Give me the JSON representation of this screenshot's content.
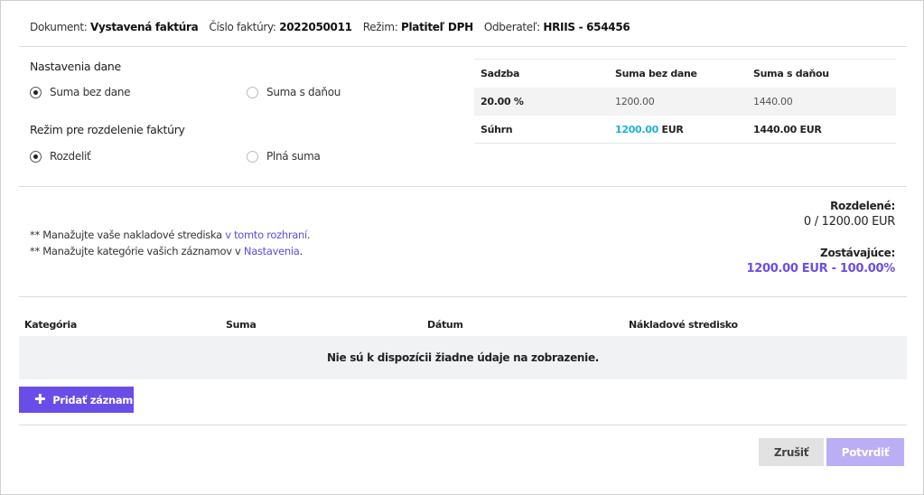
{
  "header": {
    "document_label": "Dokument:",
    "document_value": "Vystavená faktúra",
    "invoice_label": "Číslo faktúry:",
    "invoice_value": "2022050011",
    "mode_label": "Režim:",
    "mode_value": "Platiteľ DPH",
    "customer_label": "Odberateľ:",
    "customer_value": "HRIIS - 654456"
  },
  "tax_settings": {
    "title": "Nastavenia dane",
    "options": [
      "Suma bez dane",
      "Suma s daňou"
    ],
    "selected": 0
  },
  "split_mode": {
    "title": "Režim pre rozdelenie faktúry",
    "options": [
      "Rozdeliť",
      "Plná suma"
    ],
    "selected": 0
  },
  "tax_table": {
    "headers": [
      "Sadzba",
      "Suma bez dane",
      "Suma s daňou"
    ],
    "rows": [
      [
        "20.00 %",
        "1200.00",
        "1440.00"
      ]
    ],
    "summary": {
      "label": "Súhrn",
      "without_tax_value": "1200.00",
      "without_tax_currency": " EUR",
      "with_tax": "1440.00 EUR"
    }
  },
  "notes": {
    "line1_prefix": "** Manažujte vaše nakladové strediska ",
    "line1_link": "v tomto rozhraní",
    "line1_suffix": ".",
    "line2_prefix": "** Manažujte kategórie vašich záznamov v ",
    "line2_link": "Nastavenia",
    "line2_suffix": "."
  },
  "summary": {
    "distributed_label": "Rozdelené:",
    "distributed_value": "0 / 1200.00 EUR",
    "remaining_label": "Zostávajúce:",
    "remaining_value": "1200.00 EUR - 100.00%"
  },
  "grid": {
    "columns": [
      "Kategória",
      "Suma",
      "Dátum",
      "Nákladové stredisko"
    ],
    "empty_message": "Nie sú k dispozícii žiadne údaje na zobrazenie."
  },
  "actions": {
    "add_label": "Pridať záznam",
    "cancel_label": "Zrušiť",
    "confirm_label": "Potvrdiť"
  },
  "colors": {
    "accent": "#6a4de8",
    "accent_disabled": "#bcaef5",
    "link": "#5b4de0",
    "highlight_cyan": "#1bb3d6"
  }
}
